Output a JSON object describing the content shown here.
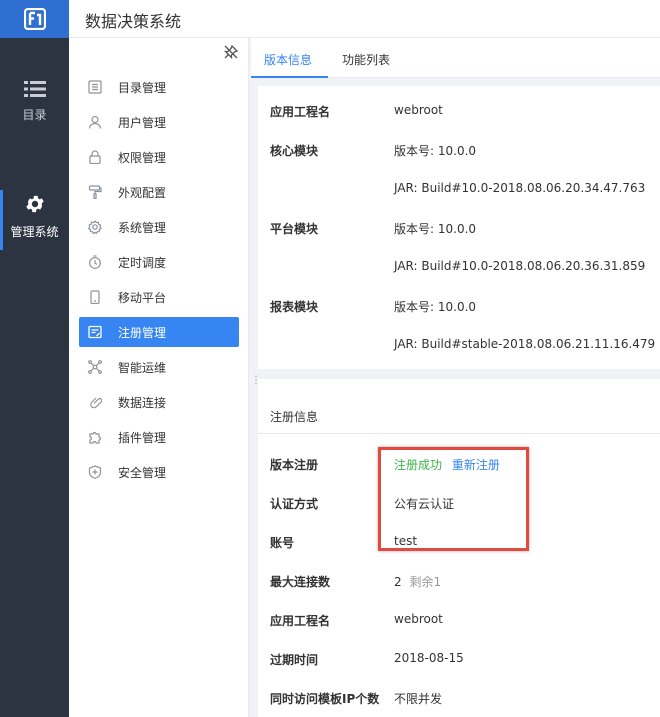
{
  "app": {
    "title": "数据决策系统",
    "logo_icon": "fr-logo-icon",
    "brand_color": "#2f6fd1"
  },
  "rail": [
    {
      "label": "目录",
      "icon": "list-icon"
    },
    {
      "label": "管理系统",
      "icon": "gear-icon",
      "active": true
    }
  ],
  "menu": [
    {
      "label": "目录管理",
      "icon": "catalog-icon"
    },
    {
      "label": "用户管理",
      "icon": "user-icon"
    },
    {
      "label": "权限管理",
      "icon": "lock-icon"
    },
    {
      "label": "外观配置",
      "icon": "paint-roller-icon"
    },
    {
      "label": "系统管理",
      "icon": "settings-icon"
    },
    {
      "label": "定时调度",
      "icon": "timer-icon"
    },
    {
      "label": "移动平台",
      "icon": "mobile-icon"
    },
    {
      "label": "注册管理",
      "icon": "register-icon",
      "active": true
    },
    {
      "label": "智能运维",
      "icon": "network-icon"
    },
    {
      "label": "数据连接",
      "icon": "link-icon"
    },
    {
      "label": "插件管理",
      "icon": "puzzle-icon"
    },
    {
      "label": "安全管理",
      "icon": "shield-icon"
    }
  ],
  "tabs": [
    {
      "label": "版本信息",
      "active": true
    },
    {
      "label": "功能列表"
    }
  ],
  "version": {
    "rows": [
      {
        "key": "应用工程名",
        "value": "webroot"
      },
      {
        "key": "核心模块",
        "value": "版本号: 10.0.0"
      },
      {
        "key": "",
        "value": "JAR: Build#10.0-2018.08.06.20.34.47.763"
      },
      {
        "key": "平台模块",
        "value": "版本号: 10.0.0"
      },
      {
        "key": "",
        "value": "JAR: Build#10.0-2018.08.06.20.36.31.859"
      },
      {
        "key": "报表模块",
        "value": "版本号: 10.0.0"
      },
      {
        "key": "",
        "value": "JAR: Build#stable-2018.08.06.21.11.16.479"
      }
    ]
  },
  "registration": {
    "section_title": "注册信息",
    "status_key": "版本注册",
    "status_value": "注册成功",
    "reregister_link": "重新注册",
    "auth_key": "认证方式",
    "auth_value": "公有云认证",
    "account_key": "账号",
    "account_value": "test",
    "max_conn_key": "最大连接数",
    "max_conn_value": "2",
    "max_conn_remaining": "剩余1",
    "app_name_key": "应用工程名",
    "app_name_value": "webroot",
    "expire_key": "过期时间",
    "expire_value": "2018-08-15",
    "concurrent_key": "同时访问模板IP个数",
    "concurrent_value": "不限并发"
  },
  "colors": {
    "accent": "#3685f2",
    "success": "#3bb44a",
    "highlight": "#e04a3f",
    "rail_bg": "#2c3442"
  }
}
